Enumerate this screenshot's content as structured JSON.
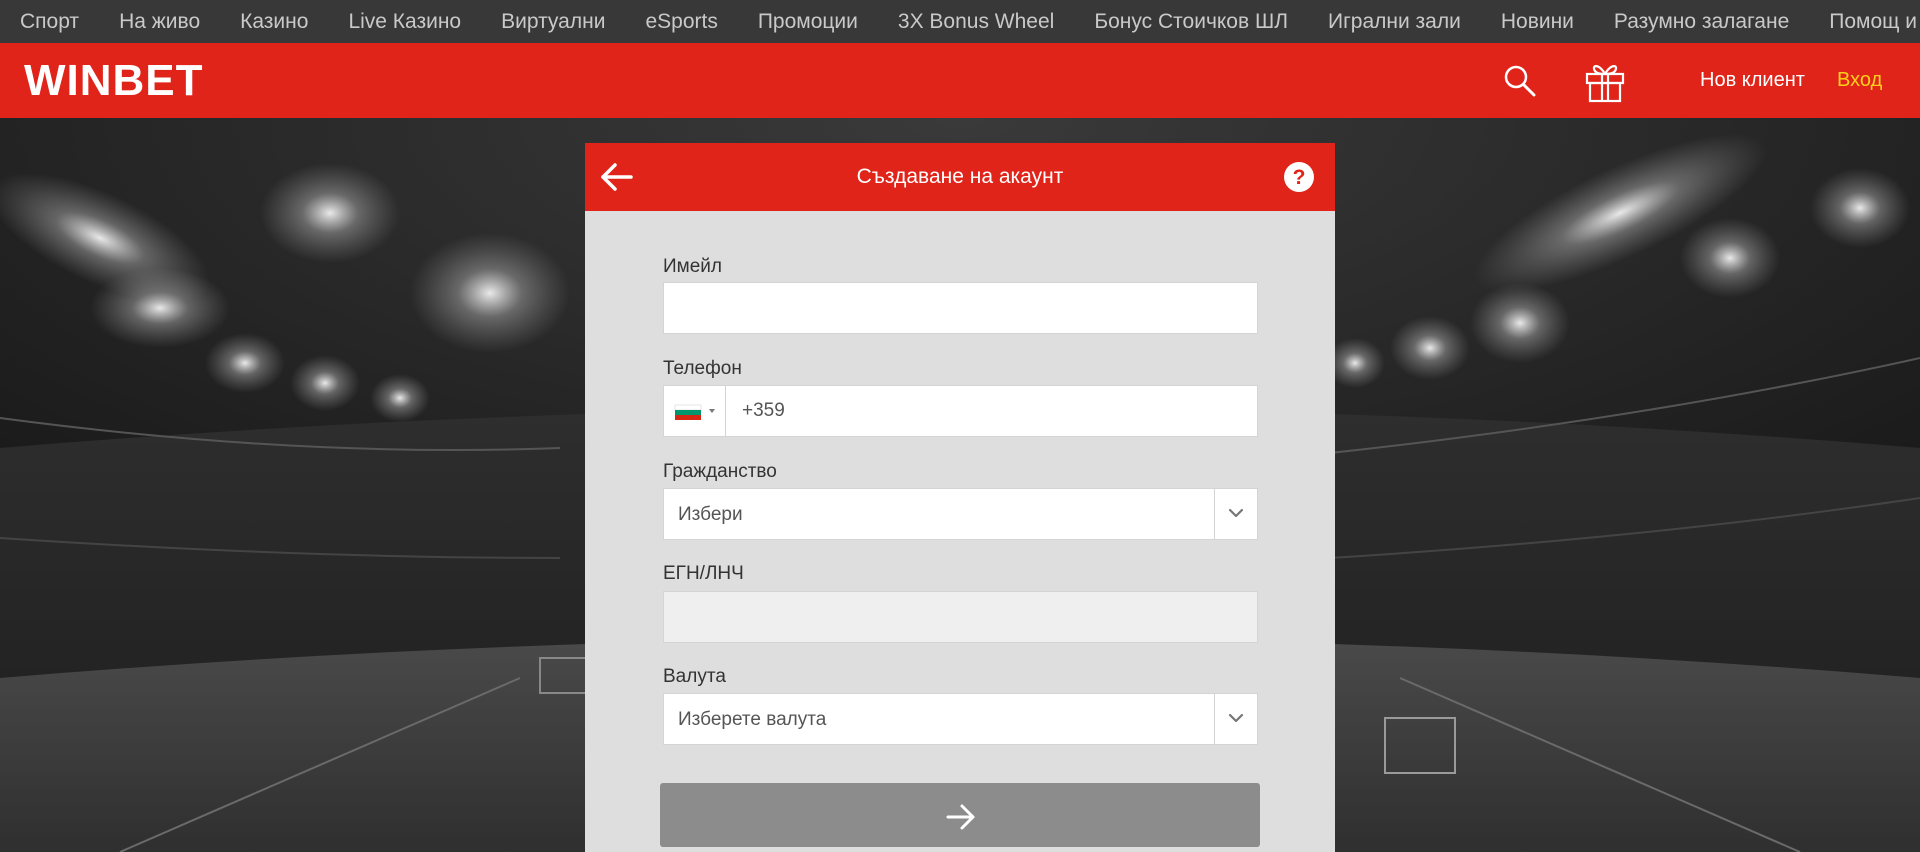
{
  "topnav": {
    "items": [
      {
        "label": "Спорт"
      },
      {
        "label": "На живо"
      },
      {
        "label": "Казино"
      },
      {
        "label": "Live Казино"
      },
      {
        "label": "Виртуални"
      },
      {
        "label": "eSports"
      },
      {
        "label": "Промоции"
      },
      {
        "label": "3X Bonus Wheel"
      },
      {
        "label": "Бонус Стоичков ШЛ"
      },
      {
        "label": "Игрални зали"
      },
      {
        "label": "Новини"
      },
      {
        "label": "Разумно залагане"
      },
      {
        "label": "Помощ и въпроси"
      }
    ]
  },
  "header": {
    "logo": "WINBET",
    "register_label": "Нов клиент",
    "login_label": "Вход",
    "icons": [
      "search-icon",
      "gift-icon"
    ]
  },
  "modal": {
    "title": "Създаване на акаунт",
    "icons": [
      "arrow-left-icon",
      "help-icon",
      "arrow-right-icon"
    ],
    "fields": {
      "email": {
        "label": "Имейл",
        "value": ""
      },
      "phone": {
        "label": "Телефон",
        "country_code": "+359",
        "flag": "bulgaria-flag-icon"
      },
      "citizenship": {
        "label": "Гражданство",
        "value": "Избери"
      },
      "egn": {
        "label": "ЕГН/ЛНЧ",
        "value": ""
      },
      "currency": {
        "label": "Валута",
        "value": "Изберете валута"
      }
    }
  },
  "colors": {
    "brand_red": "#e0241a",
    "login_yellow": "#ffcf1a",
    "nav_bg": "#383838",
    "modal_bg": "#dedede",
    "submit_disabled": "#8c8c8c"
  }
}
